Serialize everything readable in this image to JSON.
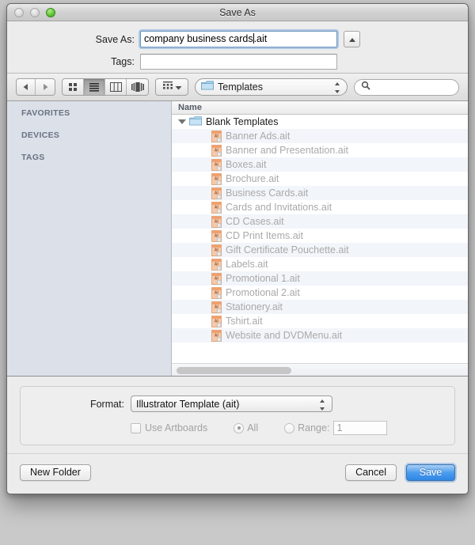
{
  "window": {
    "title": "Save As",
    "traffic_lights": [
      "close-button",
      "minimize-button",
      "zoom-button"
    ]
  },
  "name_panel": {
    "saveas_label": "Save As:",
    "saveas_value_before_caret": "company business cards",
    "saveas_value_after_caret": ".ait",
    "saveas_value": "company business cards.ait",
    "tags_label": "Tags:",
    "tags_value": "",
    "tags_placeholder": "",
    "disclosure_icon": "triangle-up-icon"
  },
  "toolbar": {
    "back_icon": "chevron-left-icon",
    "forward_icon": "chevron-right-icon",
    "view_icon_grid": "icon-view-icon",
    "view_icon_list": "list-view-icon",
    "view_icon_column": "column-view-icon",
    "view_icon_coverflow": "coverflow-view-icon",
    "active_view": "list-view-icon",
    "arrange_icon": "arrange-by-icon",
    "arrange_chevron": "chevron-down-icon",
    "path_folder_icon": "folder-icon",
    "path_label": "Templates",
    "path_stepper_icon": "stepper-updown-icon",
    "search_icon": "search-icon",
    "search_value": "",
    "search_placeholder": ""
  },
  "sidebar": {
    "sections": [
      {
        "label": "FAVORITES"
      },
      {
        "label": "DEVICES"
      },
      {
        "label": "TAGS"
      }
    ]
  },
  "file_browser": {
    "column_header": "Name",
    "folder": {
      "label": "Blank Templates",
      "expanded": true,
      "disclosure_icon": "triangle-down-icon",
      "folder_icon": "folder-icon"
    },
    "files": [
      {
        "label": "Banner Ads.ait",
        "icon": "ai-template-file-icon",
        "enabled": false
      },
      {
        "label": "Banner and Presentation.ait",
        "icon": "ai-template-file-icon",
        "enabled": false
      },
      {
        "label": "Boxes.ait",
        "icon": "ai-template-file-icon",
        "enabled": false
      },
      {
        "label": "Brochure.ait",
        "icon": "ai-template-file-icon",
        "enabled": false
      },
      {
        "label": "Business Cards.ait",
        "icon": "ai-template-file-icon",
        "enabled": false
      },
      {
        "label": "Cards and Invitations.ait",
        "icon": "ai-template-file-icon",
        "enabled": false
      },
      {
        "label": "CD Cases.ait",
        "icon": "ai-template-file-icon",
        "enabled": false
      },
      {
        "label": "CD Print Items.ait",
        "icon": "ai-template-file-icon",
        "enabled": false
      },
      {
        "label": "Gift Certificate Pouchette.ait",
        "icon": "ai-template-file-icon",
        "enabled": false
      },
      {
        "label": "Labels.ait",
        "icon": "ai-template-file-icon",
        "enabled": false
      },
      {
        "label": "Promotional 1.ait",
        "icon": "ai-template-file-icon",
        "enabled": false
      },
      {
        "label": "Promotional 2.ait",
        "icon": "ai-template-file-icon",
        "enabled": false
      },
      {
        "label": "Stationery.ait",
        "icon": "ai-template-file-icon",
        "enabled": false
      },
      {
        "label": "Tshirt.ait",
        "icon": "ai-template-file-icon",
        "enabled": false
      },
      {
        "label": "Website and DVDMenu.ait",
        "icon": "ai-template-file-icon",
        "enabled": false
      }
    ]
  },
  "options": {
    "format_label": "Format:",
    "format_value": "Illustrator Template (ait)",
    "format_stepper_icon": "stepper-updown-icon",
    "use_artboards_label": "Use Artboards",
    "use_artboards_checked": false,
    "use_artboards_enabled": false,
    "all_label": "All",
    "all_selected": true,
    "range_label": "Range:",
    "range_selected": false,
    "range_value": "1",
    "radios_enabled": false
  },
  "footer": {
    "new_folder_label": "New Folder",
    "cancel_label": "Cancel",
    "save_label": "Save"
  },
  "colors": {
    "accent_blue": "#3a8ee6",
    "window_bg": "#ececec",
    "sidebar_bg": "#dce0e8",
    "row_stripe": "#f2f5fa",
    "disabled_text": "#a9a9a9",
    "ai_icon_peach": "#f2b184"
  }
}
